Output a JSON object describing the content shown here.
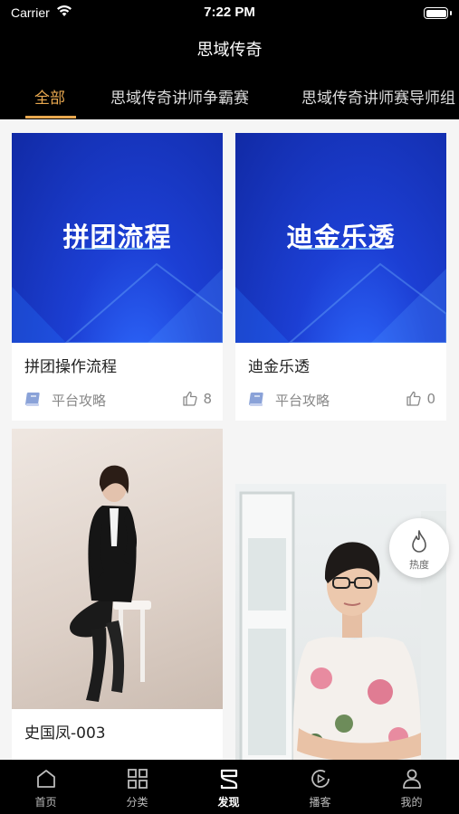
{
  "status_bar": {
    "carrier": "Carrier",
    "time": "7:22 PM"
  },
  "nav": {
    "title": "思域传奇"
  },
  "tabs": [
    {
      "label": "全部",
      "active": true
    },
    {
      "label": "思域传奇讲师争霸赛",
      "active": false
    },
    {
      "label": "思域传奇讲师赛导师组",
      "active": false
    }
  ],
  "cards": [
    {
      "thumb_text": "拼团流程",
      "title": "拼团操作流程",
      "category": "平台攻略",
      "likes": "8"
    },
    {
      "thumb_text": "迪金乐透",
      "title": "迪金乐透",
      "category": "平台攻略",
      "likes": "0"
    },
    {
      "title": "史国凤-003"
    }
  ],
  "hot_button": {
    "label": "热度",
    "icon": "flame-icon"
  },
  "tabbar": [
    {
      "label": "首页",
      "icon": "home-icon",
      "active": false
    },
    {
      "label": "分类",
      "icon": "grid-icon",
      "active": false
    },
    {
      "label": "发现",
      "icon": "discover-icon",
      "active": true
    },
    {
      "label": "播客",
      "icon": "play-icon",
      "active": false
    },
    {
      "label": "我的",
      "icon": "user-icon",
      "active": false
    }
  ],
  "colors": {
    "accent": "#e9a84f",
    "bar_bg": "#000000",
    "content_bg": "#f5f5f5"
  }
}
